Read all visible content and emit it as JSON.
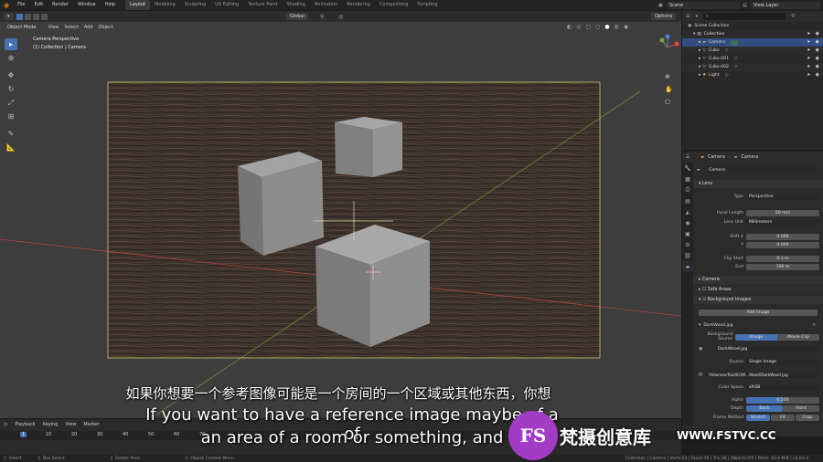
{
  "menus": [
    "File",
    "Edit",
    "Render",
    "Window",
    "Help"
  ],
  "workspaces": [
    "Layout",
    "Modeling",
    "Sculpting",
    "UV Editing",
    "Texture Paint",
    "Shading",
    "Animation",
    "Rendering",
    "Compositing",
    "Scripting"
  ],
  "scene": {
    "name": "Scene",
    "view_layer": "View Layer"
  },
  "header": {
    "orientation": "Global",
    "options": "Options"
  },
  "viewport_header": {
    "mode": "Object Mode",
    "menus": [
      "View",
      "Select",
      "Add",
      "Object"
    ]
  },
  "viewport": {
    "camera_name": "Camera Perspective",
    "collection_line": "(1) Collection | Camera"
  },
  "outliner": {
    "title": "Scene Collection",
    "rows": [
      {
        "label": "Collection",
        "depth": 1
      },
      {
        "label": "Camera",
        "depth": 2,
        "selected": true
      },
      {
        "label": "Cube",
        "depth": 2
      },
      {
        "label": "Cube.001",
        "depth": 2
      },
      {
        "label": "Cube.002",
        "depth": 2
      },
      {
        "label": "Light",
        "depth": 2
      }
    ]
  },
  "properties": {
    "breadcrumb_obj": "Camera",
    "breadcrumb_data": "Camera",
    "datablock": "Camera",
    "lens_title": "Lens",
    "type_label": "Type",
    "type_value": "Perspective",
    "focal_label": "Focal Length",
    "focal_value": "50 mm",
    "lensunit_label": "Lens Unit",
    "lensunit_value": "Millimeters",
    "shiftx_label": "Shift X",
    "shiftx_value": "0.000",
    "shifty_label": "Y",
    "shifty_value": "0.000",
    "clipstart_label": "Clip Start",
    "clipstart_value": "0.1 m",
    "clipend_label": "End",
    "clipend_value": "100 m",
    "camera_section": "Camera",
    "safe_areas": "Safe Areas",
    "bg_images": "Background Images",
    "add_image": "Add Image",
    "image_name": "DarkWood.jpg",
    "bg_source_label": "Background Source",
    "bg_source_image": "Image",
    "bg_source_movie": "Movie Clip",
    "image_datablock": "DarkWood.jpg",
    "source_label": "Source",
    "source_value": "Single Image",
    "filepath": "/Volumes/Raid0/1M...Wood/DarkWood.jpg",
    "colorspace_label": "Color Space",
    "colorspace_value": "sRGB",
    "alpha_label": "Alpha",
    "alpha_value": "0.500",
    "depth_label": "Depth",
    "depth_back": "Back",
    "depth_front": "Front",
    "frame_label": "Frame Method",
    "frame_stretch": "Stretch",
    "frame_fit": "Fit",
    "frame_crop": "Crop"
  },
  "timeline": {
    "menus": [
      "Playback",
      "Keying",
      "View",
      "Marker"
    ],
    "ticks": [
      "1",
      "10",
      "20",
      "30",
      "40",
      "50",
      "60",
      "70"
    ],
    "current_frame": "1"
  },
  "status": {
    "select": "Select",
    "box_select": "Box Select",
    "rotate_view": "Rotate View",
    "object_menu": "Object Context Menu",
    "stats": "Collection | Camera | Verts:24 | Faces:18 | Tris:36 | Objects:0/5 | Mem: 42.9 MiB | v2.83.2"
  },
  "subtitles": {
    "chinese": "如果你想要一个参考图像可能是一个房间的一个区域或其他东西，你想",
    "line1": "If you want to have a reference image maybe of a of",
    "line2": "an area of a room or something, and"
  },
  "watermark": {
    "logo": "FS",
    "text": "梵摄创意库",
    "url": "WWW.FSTVC.CC"
  },
  "colors": {
    "accent": "#4772b3",
    "viewport": "#3d3d3d",
    "camera_frame": "#c8c86a",
    "x_axis": "#c84848",
    "y_axis": "#7aa03c"
  }
}
